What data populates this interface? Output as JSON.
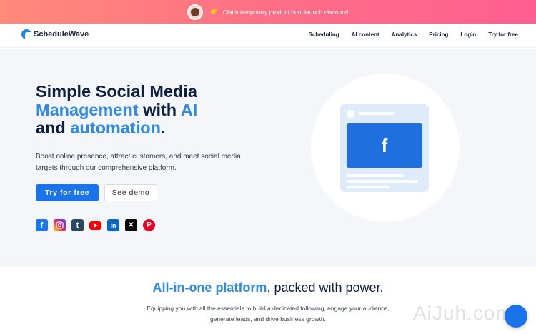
{
  "banner": {
    "hand_icon": "👉",
    "text": "Claim temporary product hunt launch discount!"
  },
  "nav": {
    "brand": "ScheduleWave",
    "links": [
      "Scheduling",
      "AI content",
      "Analytics",
      "Pricing",
      "Login",
      "Try for free"
    ]
  },
  "hero": {
    "headline": {
      "line1": "Simple Social Media",
      "accent1": "Management",
      "mid": " with ",
      "accent2": "AI",
      "and": "and ",
      "accent3": "automation",
      "period": "."
    },
    "subtitle": "Boost online presence, attract customers, and meet social media targets through our comprehensive platform.",
    "primary_cta": "Try for free",
    "secondary_cta": "See demo",
    "social_icons": [
      "facebook-icon",
      "instagram-icon",
      "tumblr-icon",
      "youtube-icon",
      "linkedin-icon",
      "x-icon",
      "pinterest-icon"
    ],
    "card_glyph": "f"
  },
  "features": {
    "title_accent": "All-in-one platform",
    "title_rest": ", packed with power.",
    "subtitle": "Equipping you with all the essentials to build a dedicated following, engage your audience, generate leads, and drive business growth."
  },
  "watermark": "AiJuh.com",
  "colors": {
    "accent": "#2e8ae6",
    "primary_button": "#1a73e8",
    "heading": "#0c1f3f",
    "banner_start": "#ff8a7a",
    "banner_end": "#ff5e92"
  }
}
